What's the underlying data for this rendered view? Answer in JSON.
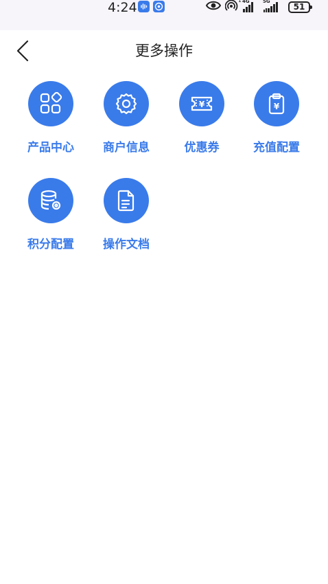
{
  "status_bar": {
    "time": "4:24",
    "net_4g": "4G",
    "net_5g": "5G",
    "hotspot_count": "1",
    "battery": "51"
  },
  "header": {
    "title": "更多操作"
  },
  "actions": [
    {
      "label": "产品中心",
      "icon": "product-grid-icon"
    },
    {
      "label": "商户信息",
      "icon": "gear-icon"
    },
    {
      "label": "优惠券",
      "icon": "coupon-icon"
    },
    {
      "label": "充值配置",
      "icon": "clipboard-yen-icon"
    },
    {
      "label": "积分配置",
      "icon": "database-gear-icon"
    },
    {
      "label": "操作文档",
      "icon": "document-icon"
    }
  ],
  "colors": {
    "accent": "#3a7bea",
    "status_bg": "#f7f4fa",
    "text": "#222222"
  }
}
